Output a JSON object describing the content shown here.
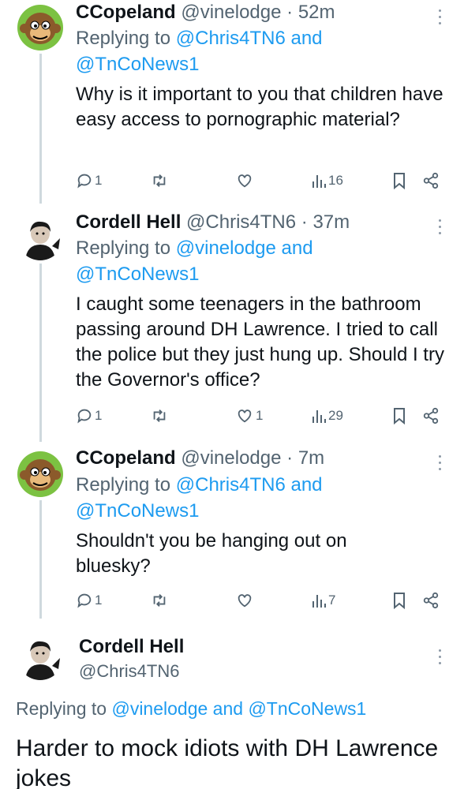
{
  "tweets": [
    {
      "name": "CCopeland",
      "handle": "@vinelodge",
      "sep": "·",
      "time": "52m",
      "reply_prefix": "Replying to ",
      "mention1": "@Chris4TN6",
      "reply_and": " and",
      "mention2": "@TnCoNews1",
      "text": "Why is it important to you that children have easy access to pornographic material?",
      "replies": "1",
      "retweets": "",
      "likes": "",
      "views": "16"
    },
    {
      "name": "Cordell Hell",
      "handle": "@Chris4TN6",
      "sep": "·",
      "time": "37m",
      "reply_prefix": "Replying to ",
      "mention1": "@vinelodge",
      "reply_and": " and",
      "mention2": "@TnCoNews1",
      "text": "I caught some teenagers in the bathroom passing around DH Lawrence. I tried to call the police but they just hung up. Should I try the Governor's office?",
      "replies": "1",
      "retweets": "",
      "likes": "1",
      "views": "29"
    },
    {
      "name": "CCopeland",
      "handle": "@vinelodge",
      "sep": "·",
      "time": "7m",
      "reply_prefix": "Replying to ",
      "mention1": "@Chris4TN6",
      "reply_and": " and",
      "mention2": "@TnCoNews1",
      "text": "Shouldn't you be hanging out on bluesky?",
      "replies": "1",
      "retweets": "",
      "likes": "",
      "views": "7"
    }
  ],
  "main_tweet": {
    "name": "Cordell Hell",
    "handle": "@Chris4TN6",
    "reply_prefix": "Replying to ",
    "mention1": "@vinelodge",
    "reply_and": " and ",
    "mention2": "@TnCoNews1",
    "text": "Harder to mock idiots with DH Lawrence jokes"
  },
  "colors": {
    "link": "#1d9bf0",
    "muted": "#536471",
    "text": "#0f1419",
    "thread_line": "#cfd9de"
  },
  "icons": [
    "reply-icon",
    "retweet-icon",
    "like-icon",
    "views-icon",
    "bookmark-icon",
    "share-icon",
    "more-icon"
  ]
}
